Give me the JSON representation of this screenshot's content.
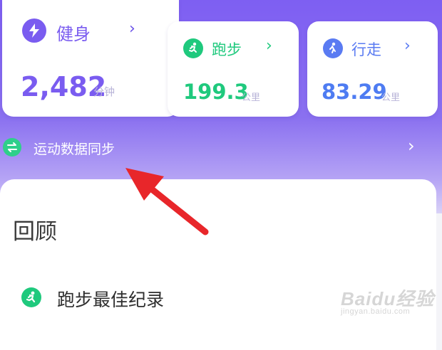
{
  "summary_cards": [
    {
      "title": "健身",
      "value": "2,482",
      "unit": "分钟",
      "icon": "lightning-icon",
      "accent": "#7a5cf0",
      "value_color": "#7a5cf0"
    },
    {
      "title": "跑步",
      "value": "199.3",
      "unit": "公里",
      "icon": "running-icon",
      "accent": "#1fc97d",
      "value_color": "#1fc97d"
    },
    {
      "title": "行走",
      "value": "83.29",
      "unit": "公里",
      "icon": "walking-icon",
      "accent": "#5a7bf2",
      "value_color": "#4e7cf2"
    }
  ],
  "sync": {
    "label": "运动数据同步",
    "icon": "sync-icon"
  },
  "review": {
    "title": "回顾",
    "items": [
      {
        "label": "跑步最佳纪录",
        "icon": "running-icon",
        "accent": "#1fc97d"
      }
    ]
  },
  "annotation": {
    "type": "red-arrow",
    "color": "#e8262a"
  },
  "watermark": {
    "main": "Baidu经验",
    "sub": "jingyan.baidu.com"
  }
}
